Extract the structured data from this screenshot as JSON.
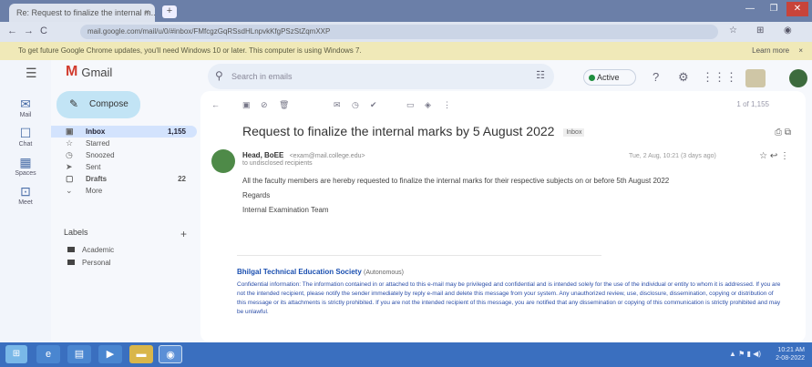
{
  "browser": {
    "tab_title": "Re: Request to finalize the internal m...",
    "tab_close": "×",
    "new_tab": "+",
    "url": "mail.google.com/mail/u/0/#inbox/FMfcgzGqRSsdHLnpvkKfgPSzStZqmXXP",
    "window_buttons": [
      "—",
      "❐",
      "✕"
    ],
    "nav": {
      "back": "←",
      "forward": "→",
      "reload": "C"
    },
    "ext_icons": [
      "☆",
      "⊞",
      "◉"
    ]
  },
  "infobar": {
    "text": "To get future Google Chrome updates, you'll need Windows 10 or later. This computer is using Windows 7.",
    "action": "Learn more",
    "close": "×"
  },
  "rail": [
    {
      "icon": "✉",
      "label": "Mail"
    },
    {
      "icon": "☐",
      "label": "Chat"
    },
    {
      "icon": "▦",
      "label": "Spaces"
    },
    {
      "icon": "⊡",
      "label": "Meet"
    }
  ],
  "header": {
    "app_name": "Gmail",
    "search_placeholder": "Search in emails",
    "status": "Active",
    "icons": [
      "?",
      "⚙",
      "⋮⋮⋮"
    ]
  },
  "compose": {
    "label": "Compose"
  },
  "nav": [
    {
      "icon": "▣",
      "label": "Inbox",
      "count": "1,155",
      "active": true
    },
    {
      "icon": "☆",
      "label": "Starred",
      "count": ""
    },
    {
      "icon": "◷",
      "label": "Snoozed",
      "count": ""
    },
    {
      "icon": "➤",
      "label": "Sent",
      "count": ""
    },
    {
      "icon": "▢",
      "label": "Drafts",
      "count": "22"
    },
    {
      "icon": "⌄",
      "label": "More",
      "count": ""
    }
  ],
  "labels": {
    "heading": "Labels",
    "add": "+",
    "items": [
      "Academic",
      "Personal"
    ]
  },
  "toolbar": {
    "icons": [
      "←",
      "▣",
      "⊘",
      "🗑",
      "✉",
      "◷",
      "✔",
      "▭",
      "◈",
      "⋮"
    ],
    "pager": "1 of 1,155"
  },
  "message": {
    "subject": "Request to finalize the internal marks by 5 August 2022",
    "inbox_tag": "Inbox",
    "subject_icons": "⎙ ⧉",
    "sender_name": "Head, BoEE",
    "sender_addr": "<exam@mail.college.edu>",
    "to": "to undisclosed recipients",
    "date": "Tue, 2 Aug, 10:21 (3 days ago)",
    "msg_icons": "☆  ↩  ⋮",
    "body": [
      "All the faculty members are hereby requested to finalize the internal marks for their respective subjects on or before 5th August 2022",
      "Regards",
      "Internal Examination Team"
    ],
    "sig_name": "Bhilgal Technical Education Society",
    "sig_note": "(Autonomous)",
    "disclaimer": "Confidential information: The information contained in or attached to this e-mail may be privileged and confidential and is intended solely for the use of the individual or entity to whom it is addressed. If you are not the intended recipient, please notify the sender immediately by reply e-mail and delete this message from your system. Any unauthorized review, use, disclosure, dissemination, copying or distribution of this message or its attachments is strictly prohibited. If you are not the intended recipient of this message, you are notified that any dissemination or copying of this communication is strictly prohibited and may be unlawful."
  },
  "taskbar": {
    "start": "⊞",
    "apps": [
      "e",
      "▤",
      "▶",
      "▬",
      "◉"
    ],
    "tray_icons": "▲ ⚑ ▮ ◀)",
    "time": "10:21 AM",
    "date": "2-08-2022"
  }
}
